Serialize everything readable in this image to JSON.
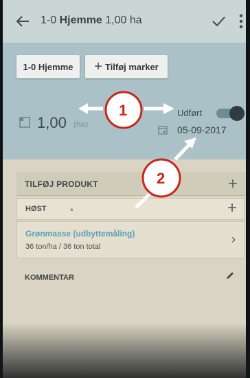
{
  "appbar": {
    "title_prefix": "1-0 ",
    "title_bold": "Hjemme",
    "title_suffix": " 1,00 ha"
  },
  "chips": {
    "field": "1-0 Hjemme",
    "add_marker": "Tilføj marker"
  },
  "area": {
    "value": "1,00",
    "unit": "(ha)"
  },
  "status": {
    "done_label": "Udført",
    "done": true,
    "date": "05-09-2017"
  },
  "product_section": {
    "title": "TILFØJ PRODUKT",
    "group": "HØST",
    "item_name": "Grønmasse (udbyttemåling)",
    "item_amount": "36 ton/ha  /  36 ton total"
  },
  "comment_section": {
    "title": "KOMMENTAR"
  },
  "callouts": {
    "one": "1",
    "two": "2"
  },
  "colors": {
    "appbar": "#c9d6d4",
    "top_panel": "#a9c1c7",
    "product_link": "#5aa0b6",
    "callout": "#c8261c"
  }
}
